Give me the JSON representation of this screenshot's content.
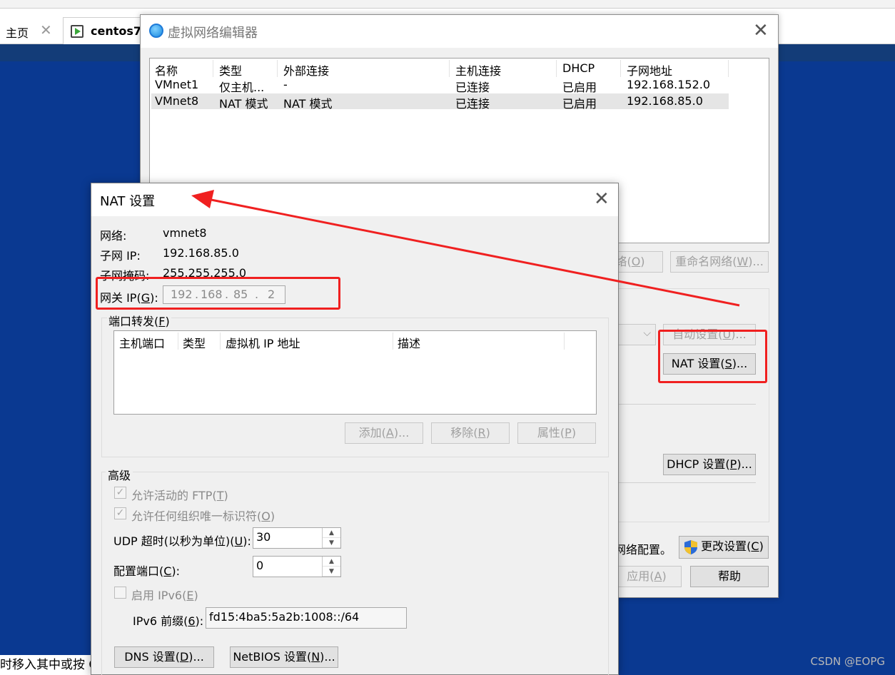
{
  "vmware": {
    "tabs": [
      {
        "label": "主页"
      },
      {
        "label": "centos7"
      }
    ],
    "status_text": "时移入其中或按 C",
    "watermark": "CSDN @EOPG"
  },
  "net_editor": {
    "title": "虚拟网络编辑器",
    "columns": [
      "名称",
      "类型",
      "外部连接",
      "主机连接",
      "DHCP",
      "子网地址"
    ],
    "rows": [
      {
        "name": "VMnet1",
        "type": "仅主机...",
        "external": "-",
        "host": "已连接",
        "dhcp": "已启用",
        "subnet": "192.168.152.0",
        "selected": false
      },
      {
        "name": "VMnet8",
        "type": "NAT 模式",
        "external": "NAT 模式",
        "host": "已连接",
        "dhcp": "已启用",
        "subnet": "192.168.85.0",
        "selected": true
      }
    ],
    "remove_net_button": {
      "text": "络(",
      "key": "O",
      "tail": ")"
    },
    "rename_net_button": {
      "text": "重命名网络(",
      "key": "W",
      "tail": ")..."
    },
    "auto_settings_button": {
      "text": "自动设置(",
      "key": "U",
      "tail": ")..."
    },
    "nat_settings_button": {
      "text": "NAT 设置(",
      "key": "S",
      "tail": ")..."
    },
    "dhcp_settings_button": {
      "text": "DHCP 设置(",
      "key": "P",
      "tail": ")..."
    },
    "admin_note": "网络配置。",
    "change_settings_button": {
      "text": "更改设置(",
      "key": "C",
      "tail": ")"
    },
    "apply_button": {
      "text": "应用(",
      "key": "A",
      "tail": ")"
    },
    "help_button": "帮助"
  },
  "nat_dialog": {
    "title": "NAT 设置",
    "network_label": "网络:",
    "network_value": "vmnet8",
    "subnet_ip_label": "子网 IP:",
    "subnet_ip_value": "192.168.85.0",
    "subnet_mask_label": "子网掩码:",
    "subnet_mask_value": "255.255.255.0",
    "gateway_label": {
      "text": "网关 IP(",
      "key": "G",
      "tail": "):"
    },
    "gateway_octets": [
      "192",
      "168",
      "85",
      "2"
    ],
    "port_forward_label": {
      "text": "端口转发(",
      "key": "F",
      "tail": ")"
    },
    "port_columns": [
      "主机端口",
      "类型",
      "虚拟机 IP 地址",
      "描述"
    ],
    "add_button": {
      "text": "添加(",
      "key": "A",
      "tail": ")..."
    },
    "remove_button": {
      "text": "移除(",
      "key": "R",
      "tail": ")"
    },
    "properties_button": {
      "text": "属性(",
      "key": "P",
      "tail": ")"
    },
    "advanced_label": "高级",
    "allow_ftp": {
      "text": "允许活动的 FTP(",
      "key": "T",
      "tail": ")",
      "checked": true
    },
    "allow_oui": {
      "text": "允许任何组织唯一标识符(",
      "key": "O",
      "tail": ")",
      "checked": true
    },
    "udp_timeout_label": {
      "text": "UDP 超时(以秒为单位)(",
      "key": "U",
      "tail": "):"
    },
    "udp_timeout_value": "30",
    "config_port_label": {
      "text": "配置端口(",
      "key": "C",
      "tail": "):"
    },
    "config_port_value": "0",
    "enable_ipv6": {
      "text": "启用 IPv6(",
      "key": "E",
      "tail": ")",
      "checked": false
    },
    "ipv6_prefix_label": {
      "text": "IPv6 前缀(",
      "key": "6",
      "tail": "):"
    },
    "ipv6_prefix_value": "fd15:4ba5:5a2b:1008::/64",
    "dns_button": {
      "text": "DNS 设置(",
      "key": "D",
      "tail": ")..."
    },
    "netbios_button": {
      "text": "NetBIOS 设置(",
      "key": "N",
      "tail": ")..."
    }
  },
  "colors": {
    "vm_desktop": "#0a3991",
    "annotation_red": "#f02020",
    "dialog_bg": "#f0f0f0"
  }
}
